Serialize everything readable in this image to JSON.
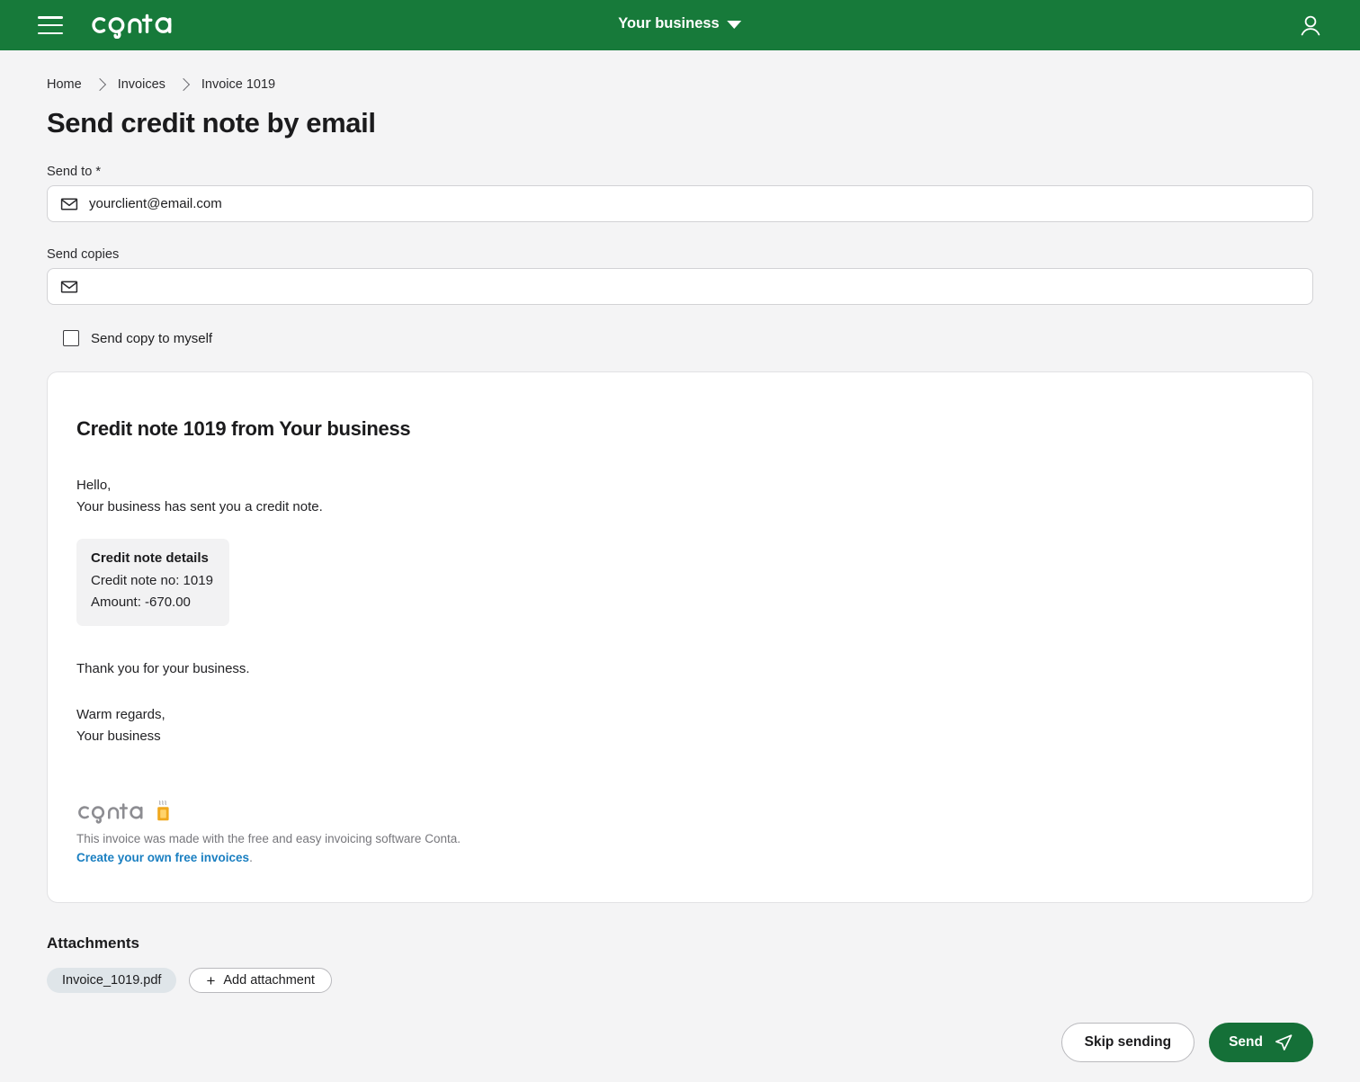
{
  "header": {
    "menu_icon": "hamburger-icon",
    "logo_text": "conta",
    "business_switcher": "Your business",
    "caret_icon": "chevron-down-icon",
    "account_icon": "user-icon"
  },
  "breadcrumb": {
    "items": [
      {
        "label": "Home"
      },
      {
        "label": "Invoices"
      },
      {
        "label": "Invoice 1019"
      }
    ]
  },
  "page": {
    "title": "Send credit note by email"
  },
  "form": {
    "send_to": {
      "label": "Send to",
      "required_mark": "*",
      "icon": "envelope-icon",
      "value": "yourclient@email.com",
      "placeholder": ""
    },
    "send_copies": {
      "label": "Send copies",
      "icon": "envelope-icon",
      "value": "",
      "placeholder": ""
    },
    "copy_to_myself": {
      "label": "Send copy to myself",
      "checked": false
    }
  },
  "email_preview": {
    "subject": "Credit note 1019 from Your business",
    "greeting": "Hello,",
    "intro": "Your business has sent you a credit note.",
    "details": {
      "title": "Credit note details",
      "number_line": "Credit note no: 1019",
      "amount_line": "Amount: -670.00"
    },
    "thanks": "Thank you for your business.",
    "signoff": "Warm regards,",
    "sender": "Your business",
    "footer": {
      "logo_text": "conta",
      "logo_icon": "coffee-cup-icon",
      "note": "This invoice was made with the free and easy invoicing software Conta.",
      "link_text": "Create your own free invoices",
      "link_period": "."
    }
  },
  "attachments": {
    "title": "Attachments",
    "files": [
      {
        "name": "Invoice_1019.pdf"
      }
    ],
    "add_button": "Add attachment",
    "add_icon": "plus-icon"
  },
  "actions": {
    "skip_label": "Skip sending",
    "send_label": "Send",
    "send_icon": "paper-plane-icon"
  },
  "colors": {
    "brand_green": "#177A3A",
    "send_button_green": "#157038",
    "page_background": "#f4f4f5",
    "link_blue": "#1a7fc1",
    "attachment_pill": "#dfe5e9",
    "coffee_cup_yellow": "#f5b731"
  }
}
